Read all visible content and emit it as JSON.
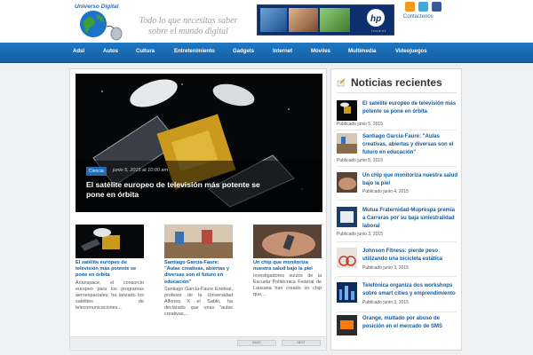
{
  "site": {
    "logo_text": "Universo Digital",
    "slogan_line1": "Todo lo que necesitas saber",
    "slogan_line2": "sobre el mundo digital",
    "banner_text": "invent",
    "contact_label": "Contáctenos"
  },
  "nav": [
    "Adsl",
    "Autos",
    "Cultura",
    "Entretenimiento",
    "Gadgets",
    "Internet",
    "Móviles",
    "Multimedia",
    "Videojuegos"
  ],
  "featured": {
    "category": "Ciencia",
    "date": "junio 5, 2015 at 10:00 am",
    "title_line1": "El satélite europeo de televisión más potente se",
    "title_line2": "pone en órbita"
  },
  "columns": [
    {
      "title": "El satélite europeo de televisión más potente se pone en órbita",
      "excerpt": "Arianspace, el consorcio europeo para los programas aeroespaciales, ha lanzado los satélites de telecomunicaciones..."
    },
    {
      "title": "Santiago García-Faure: \"Aulas creativas, abiertas y diversas son el futuro en educación\"",
      "excerpt": "Santiago García-Faure Enebral, profesor de la Universidad Alfonso X el Sabio, ha declarado que unas \"aulas creativas,..."
    },
    {
      "title": "Un chip que monitoriza nuestra salud bajo la piel",
      "excerpt": "Investigadores suizos de la Escuela Politécnica Federal de Lausana han creado un chip que,..."
    }
  ],
  "pager": {
    "back": "BACK",
    "next": "NEXT"
  },
  "sidebar": {
    "title": "Noticias recientes",
    "items": [
      {
        "title": "El satélite europeo de televisión más potente se pone en órbita",
        "date": "Publicado junio 5, 2015"
      },
      {
        "title": "Santiago García-Faure: \"Aulas creativas, abiertas y diversas son el futuro en educación\"",
        "date": "Publicado junio 5, 2015"
      },
      {
        "title": "Un chip que monitoriza nuestra salud bajo la piel",
        "date": "Publicado junio 4, 2015"
      },
      {
        "title": "Mutua Fraternidad-Muprespa premia a Carreras por su baja siniestralidad laboral",
        "date": "Publicado junio 3, 2015"
      },
      {
        "title": "Johnson Fitness: pierde peso utilizando una bicicleta estática",
        "date": "Publicado junio 3, 2015"
      },
      {
        "title": "Telefónica organiza dos workshops sobre smart cities y emprendimiento",
        "date": "Publicado junio 3, 2015"
      },
      {
        "title": "Orange, multado por abuso de posición en el mercado de SMS",
        "date": ""
      }
    ]
  },
  "colors": {
    "nav_top": "#1f77c2",
    "nav_bottom": "#155fa3",
    "link": "#0f5a9c",
    "category": "#1d6cb5"
  },
  "icons": [
    "globe-logo-icon",
    "mouse-icon",
    "rss-icon",
    "twitter-icon",
    "facebook-icon",
    "hp-logo-icon",
    "pencil-icon"
  ]
}
